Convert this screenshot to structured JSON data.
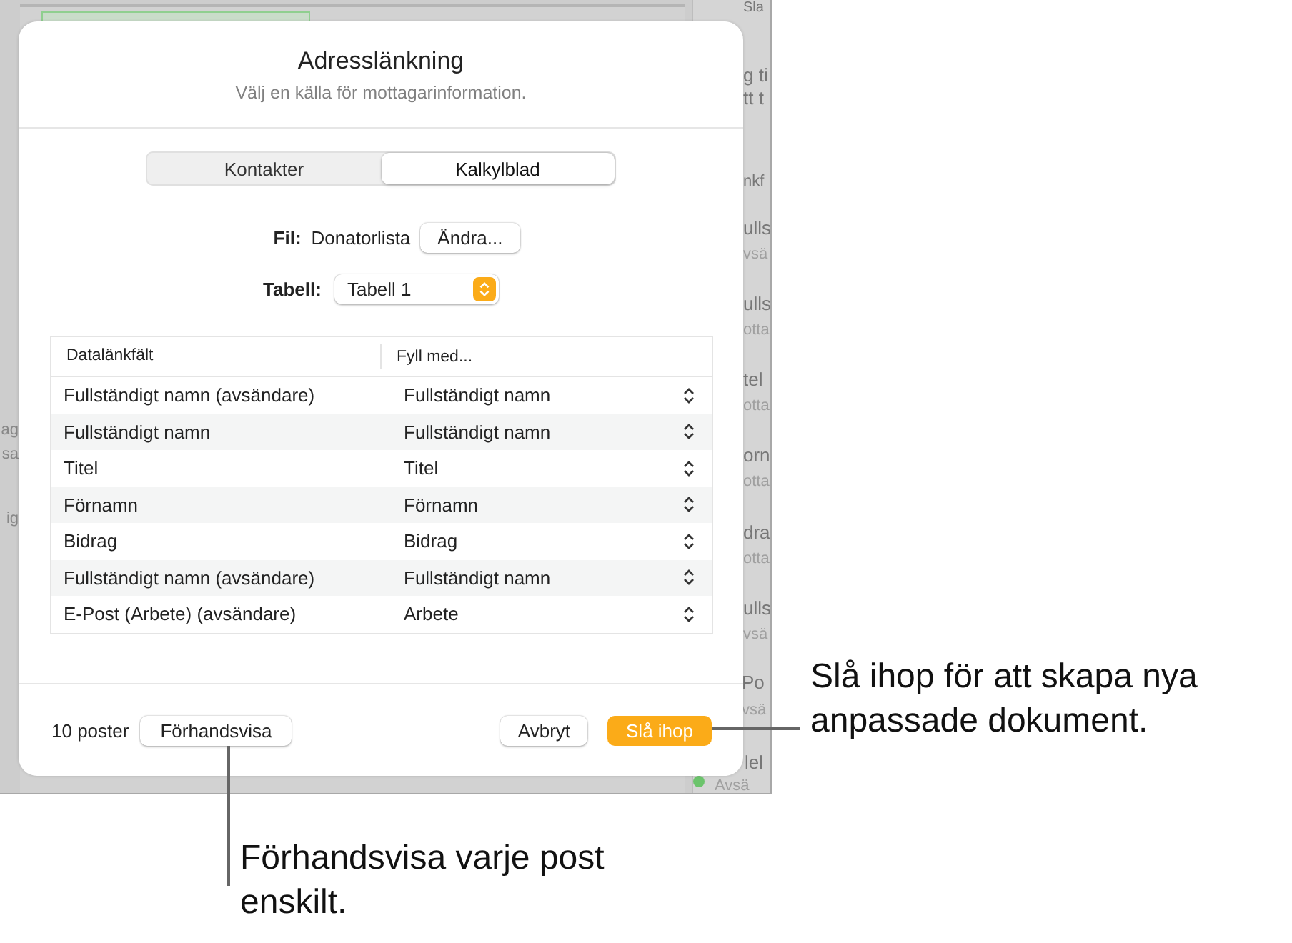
{
  "background": {
    "left_fragments": [
      "ag",
      "sa",
      "ig"
    ],
    "right_fragments": [
      "Sla",
      "g ti",
      "tt t",
      "nkf",
      "ulls",
      "vsä",
      "ulls",
      "otta",
      "tel",
      "otta",
      "orn",
      "otta",
      "dra",
      "otta",
      "ulls",
      "vsä",
      "Po",
      "vsä",
      "lel",
      "Avsä"
    ]
  },
  "dialog": {
    "title": "Adresslänkning",
    "subtitle": "Välj en källa för mottagarinformation.",
    "tabs": [
      {
        "label": "Kontakter",
        "selected": false
      },
      {
        "label": "Kalkylblad",
        "selected": true
      }
    ],
    "file": {
      "label": "Fil:",
      "value": "Donatorlista",
      "button": "Ändra..."
    },
    "table_select": {
      "label": "Tabell:",
      "value": "Tabell 1"
    },
    "table": {
      "columns": [
        "Datalänkfält",
        "Fyll med..."
      ],
      "rows": [
        {
          "field": "Fullständigt namn (avsändare)",
          "fill": "Fullständigt namn"
        },
        {
          "field": "Fullständigt namn",
          "fill": "Fullständigt namn"
        },
        {
          "field": "Titel",
          "fill": "Titel"
        },
        {
          "field": "Förnamn",
          "fill": "Förnamn"
        },
        {
          "field": "Bidrag",
          "fill": "Bidrag"
        },
        {
          "field": "Fullständigt namn (avsändare)",
          "fill": "Fullständigt namn"
        },
        {
          "field": "E-Post (Arbete) (avsändare)",
          "fill": "Arbete"
        }
      ]
    },
    "footer": {
      "count": "10 poster",
      "preview_button": "Förhandsvisa",
      "cancel_button": "Avbryt",
      "merge_button": "Slå ihop"
    }
  },
  "callouts": [
    {
      "kind": "right",
      "text": "Slå ihop för att skapa nya anpassade dokument."
    },
    {
      "kind": "below",
      "text": "Förhandsvisa varje post enskilt."
    }
  ]
}
